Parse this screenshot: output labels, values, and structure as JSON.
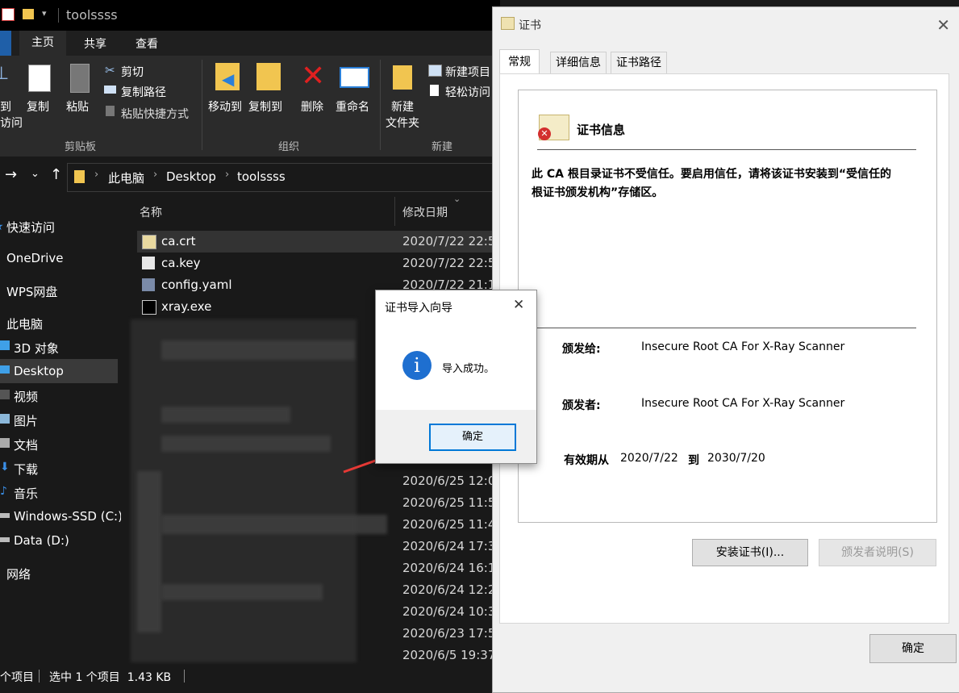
{
  "explorer": {
    "title": "toolssss",
    "ribbon_tabs": [
      "主页",
      "共享",
      "查看"
    ],
    "clipboard": {
      "pin_label_1": "到",
      "pin_label_2": "访问",
      "copy": "复制",
      "paste": "粘贴",
      "cut": "剪切",
      "copy_path": "复制路径",
      "paste_shortcut": "粘贴快捷方式",
      "group": "剪贴板"
    },
    "organize": {
      "move_to": "移动到",
      "copy_to": "复制到",
      "delete": "删除",
      "rename": "重命名",
      "group": "组织"
    },
    "new": {
      "new_folder_1": "新建",
      "new_folder_2": "文件夹",
      "new_item": "新建项目",
      "easy_access": "轻松访问",
      "group": "新建"
    },
    "address": [
      "此电脑",
      "Desktop",
      "toolssss"
    ],
    "nav_items": [
      "快速访问",
      "OneDrive",
      "WPS网盘",
      "此电脑",
      "3D 对象",
      "Desktop",
      "视频",
      "图片",
      "文档",
      "下载",
      "音乐",
      "Windows-SSD (C:)",
      "Data (D:)",
      "网络"
    ],
    "columns": {
      "name": "名称",
      "date": "修改日期"
    },
    "files": [
      {
        "name": "ca.crt",
        "date": "2020/7/22 22:5"
      },
      {
        "name": "ca.key",
        "date": "2020/7/22 22:5"
      },
      {
        "name": "config.yaml",
        "date": "2020/7/22 21:1"
      },
      {
        "name": "xray.exe",
        "date": ""
      }
    ],
    "dates": [
      "2020/6/25 12:0",
      "2020/6/25 11:5",
      "2020/6/25 11:4",
      "2020/6/24 17:3",
      "2020/6/24 16:1",
      "2020/6/24 12:2",
      "2020/6/24 10:3",
      "2020/6/23 17:5",
      "2020/6/5 19:37"
    ],
    "status": {
      "count": "个项目",
      "selected": "选中 1 个项目  1.43 KB"
    }
  },
  "cert": {
    "title": "证书",
    "tabs": [
      "常规",
      "详细信息",
      "证书路径"
    ],
    "info_heading": "证书信息",
    "warning": "此 CA 根目录证书不受信任。要启用信任，请将该证书安装到“受信任的根证书颁发机构”存储区。",
    "issued_to_label": "颁发给:",
    "issued_to": "Insecure Root CA For X-Ray Scanner",
    "issued_by_label": "颁发者:",
    "issued_by": "Insecure Root CA For X-Ray Scanner",
    "valid_label": "有效期从",
    "valid_from": "2020/7/22",
    "to_label": "到",
    "valid_to": "2030/7/20",
    "install_button": "安装证书(I)...",
    "issuer_statement_button": "颁发者说明(S)",
    "ok_button": "确定"
  },
  "wizard": {
    "title": "证书导入向导",
    "message": "导入成功。",
    "ok_button": "确定"
  },
  "colors": {
    "accent": "#0078d7",
    "arrow": "#e53935"
  }
}
